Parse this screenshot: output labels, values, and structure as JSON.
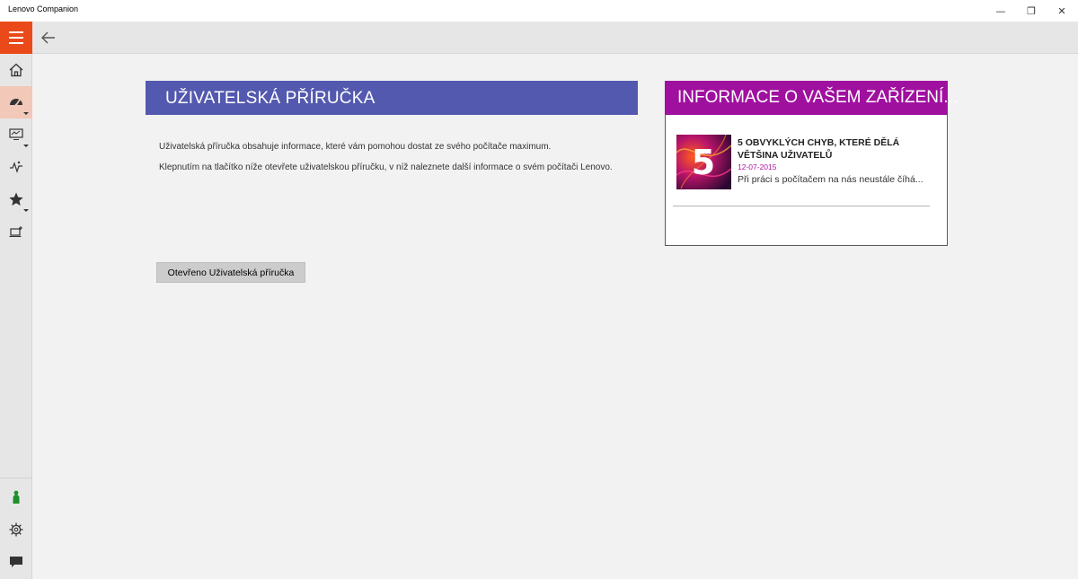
{
  "window": {
    "title": "Lenovo Companion",
    "minimize_glyph": "—",
    "maximize_glyph": "❐",
    "close_glyph": "✕"
  },
  "topbar": {
    "menu_icon": "hamburger-icon",
    "back_icon": "back-arrow-icon",
    "accent": "#ea4a1a"
  },
  "sidebar": {
    "items": [
      {
        "name": "home",
        "icon": "home-icon"
      },
      {
        "name": "dashboard",
        "icon": "speedometer-icon",
        "active": true,
        "has_submenu": true
      },
      {
        "name": "system",
        "icon": "monitor-icon",
        "has_submenu": true
      },
      {
        "name": "diagnostics",
        "icon": "heartbeat-icon"
      },
      {
        "name": "favorites",
        "icon": "star-icon",
        "has_submenu": true
      },
      {
        "name": "devices",
        "icon": "laptop-icon"
      }
    ],
    "bottom_items": [
      {
        "name": "account",
        "icon": "person-icon"
      },
      {
        "name": "settings",
        "icon": "gear-icon"
      },
      {
        "name": "feedback",
        "icon": "chat-icon"
      }
    ]
  },
  "guide": {
    "title": "UŽIVATELSKÁ PŘÍRUČKA",
    "paragraph_1": "Uživatelská příručka obsahuje informace, které vám pomohou dostat ze svého počítače maximum.",
    "paragraph_2": "Klepnutím na tlačítko níže otevřete uživatelskou příručku, v níž naleznete další informace o svém počítači Lenovo.",
    "button_label": "Otevřeno Uživatelská příručka",
    "header_color": "#5359ae"
  },
  "info_panel": {
    "title": "INFORMACE O VAŠEM ZAŘÍZENÍ...",
    "header_color": "#a0109f",
    "article": {
      "title": "5 OBVYKLÝCH CHYB, KTERÉ DĚLÁ VĚTŠINA UŽIVATELŮ",
      "date": "12-07-2015",
      "excerpt": "Při práci s počítačem na nás neustále číhá...",
      "thumbnail_glyph": "5"
    }
  }
}
